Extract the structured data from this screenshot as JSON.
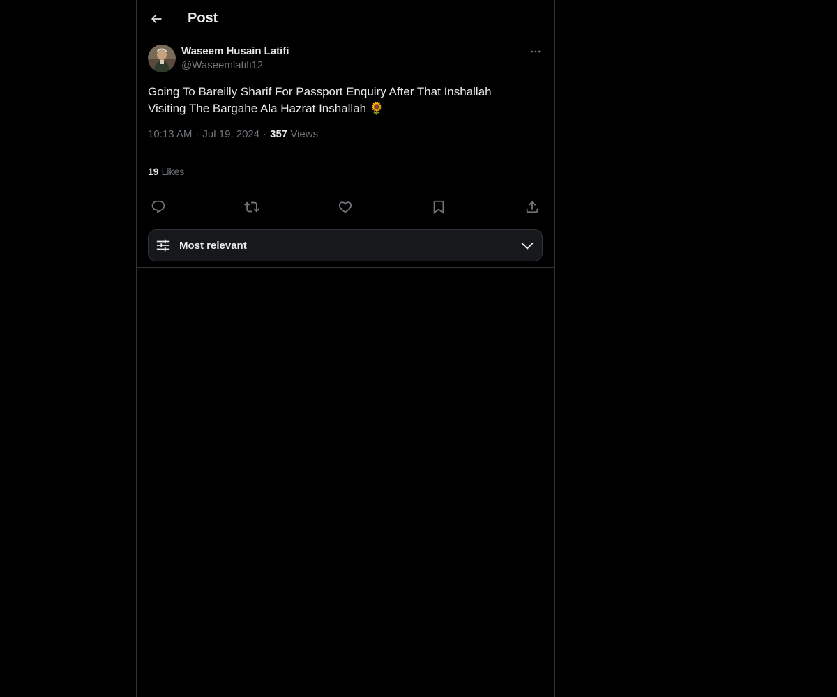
{
  "header": {
    "title": "Post",
    "back_icon": "arrow-left-icon"
  },
  "post": {
    "author_name": "Waseem Husain Latifi",
    "author_handle": "@Waseemlatifi12",
    "text": "Going To Bareilly Sharif For Passport Enquiry After That Inshallah Visiting The Bargahe Ala Hazrat Inshallah 🌻",
    "time": "10:13 AM",
    "separator": "·",
    "date": "Jul 19, 2024",
    "views_count": "357",
    "views_label": "Views",
    "likes_count": "19",
    "likes_label": "Likes"
  },
  "actions": {
    "reply_icon": "reply-icon",
    "repost_icon": "repost-icon",
    "like_icon": "heart-icon",
    "bookmark_icon": "bookmark-icon",
    "share_icon": "share-icon"
  },
  "sort": {
    "label": "Most relevant",
    "icon": "sliders-icon"
  },
  "colors": {
    "background": "#000000",
    "text_primary": "#e7e9ea",
    "text_secondary": "#71767b",
    "border": "#2f3336"
  }
}
